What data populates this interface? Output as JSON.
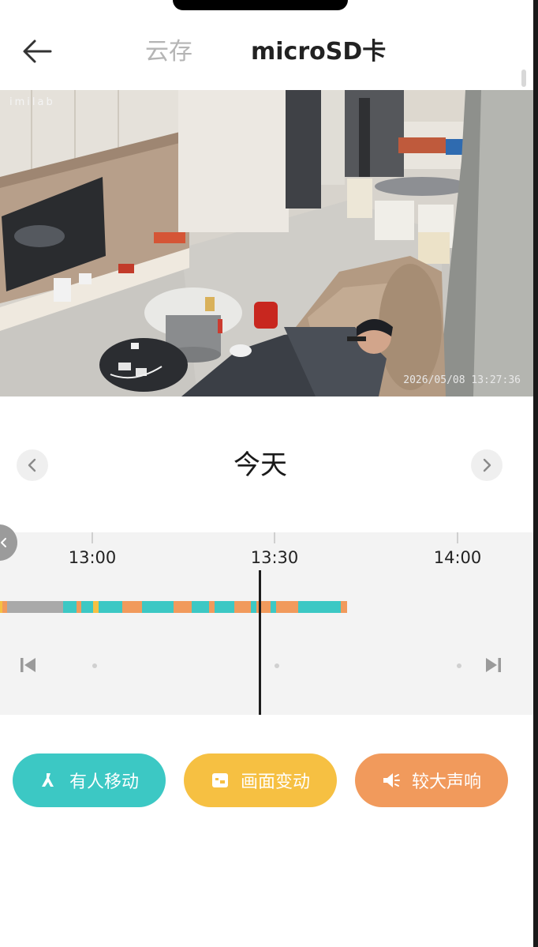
{
  "header": {
    "tabs": [
      {
        "label": "云存",
        "active": false
      },
      {
        "label": "microSD卡",
        "active": true
      }
    ]
  },
  "video": {
    "watermark": "imilab",
    "timestamp": "2026/05/08 13:27:36"
  },
  "date_nav": {
    "label": "今天"
  },
  "timeline": {
    "ticks": [
      "13:00",
      "13:30",
      "14:00"
    ],
    "colors": {
      "person": "#3cc8c4",
      "change": "#f6c042",
      "sound": "#f19a5c",
      "plain": "#a9a9a9"
    }
  },
  "filters": [
    {
      "label": "有人移动",
      "icon": "person-walking-icon",
      "color": "#3cc8c4"
    },
    {
      "label": "画面变动",
      "icon": "screen-change-icon",
      "color": "#f6c042"
    },
    {
      "label": "较大声响",
      "icon": "speaker-icon",
      "color": "#f19a5c"
    }
  ]
}
